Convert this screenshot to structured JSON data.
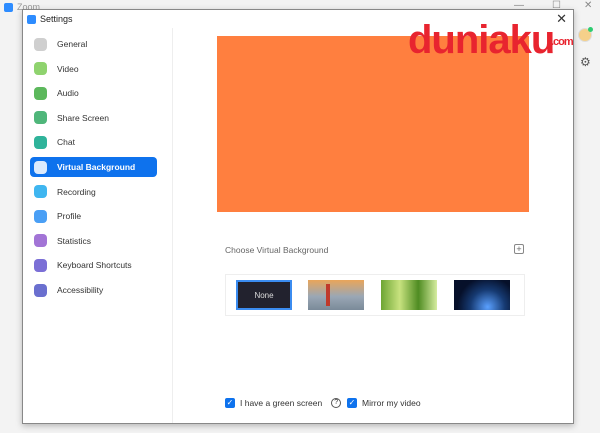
{
  "background_app": {
    "title": "Zoom",
    "minimize": "—",
    "maximize": "☐",
    "close": "✕"
  },
  "settings": {
    "title": "Settings",
    "close": "✕",
    "sidebar": [
      {
        "label": "General",
        "color": "#cfcfcf"
      },
      {
        "label": "Video",
        "color": "#8fd36e"
      },
      {
        "label": "Audio",
        "color": "#5cb85c"
      },
      {
        "label": "Share Screen",
        "color": "#4fb67a"
      },
      {
        "label": "Chat",
        "color": "#2fb39a"
      },
      {
        "label": "Virtual Background",
        "color": "#ffffff",
        "active": true
      },
      {
        "label": "Recording",
        "color": "#3fb6f0"
      },
      {
        "label": "Profile",
        "color": "#4a9ff5"
      },
      {
        "label": "Statistics",
        "color": "#a274d6"
      },
      {
        "label": "Keyboard Shortcuts",
        "color": "#7b6fd6"
      },
      {
        "label": "Accessibility",
        "color": "#6a6fcf"
      }
    ],
    "preview_color": "#ff7f3f",
    "choose_label": "Choose Virtual Background",
    "add_label": "+",
    "none_label": "None",
    "green_screen_label": "I have a green screen",
    "help": "?",
    "mirror_label": "Mirror my video",
    "green_screen_checked": true,
    "mirror_checked": true
  },
  "watermark": {
    "text": "duniaku",
    ".com": ".com"
  }
}
